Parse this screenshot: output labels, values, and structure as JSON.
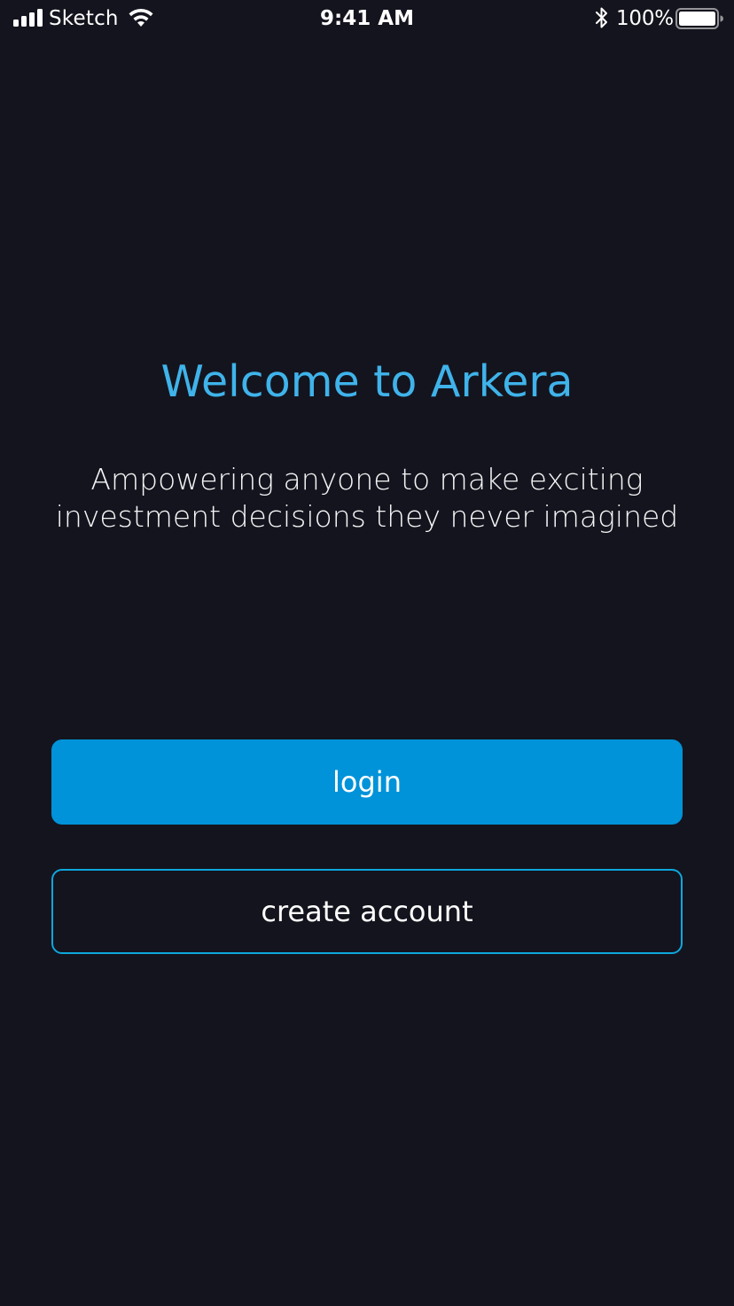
{
  "status_bar": {
    "carrier": "Sketch",
    "time": "9:41 AM",
    "battery_percent": "100%",
    "icons": [
      "signal-icon",
      "wifi-icon",
      "bluetooth-icon",
      "battery-icon"
    ]
  },
  "welcome": {
    "title": "Welcome to Arkera",
    "tagline_line1": "Ampowering anyone to make exciting",
    "tagline_line2": "investment decisions they never imagined"
  },
  "actions": {
    "login_label": "login",
    "create_account_label": "create account"
  },
  "colors": {
    "background": "#14141e",
    "accent": "#3fb3ea",
    "primary_button": "#0093d9",
    "outline_button_border": "#0ea7dd"
  }
}
